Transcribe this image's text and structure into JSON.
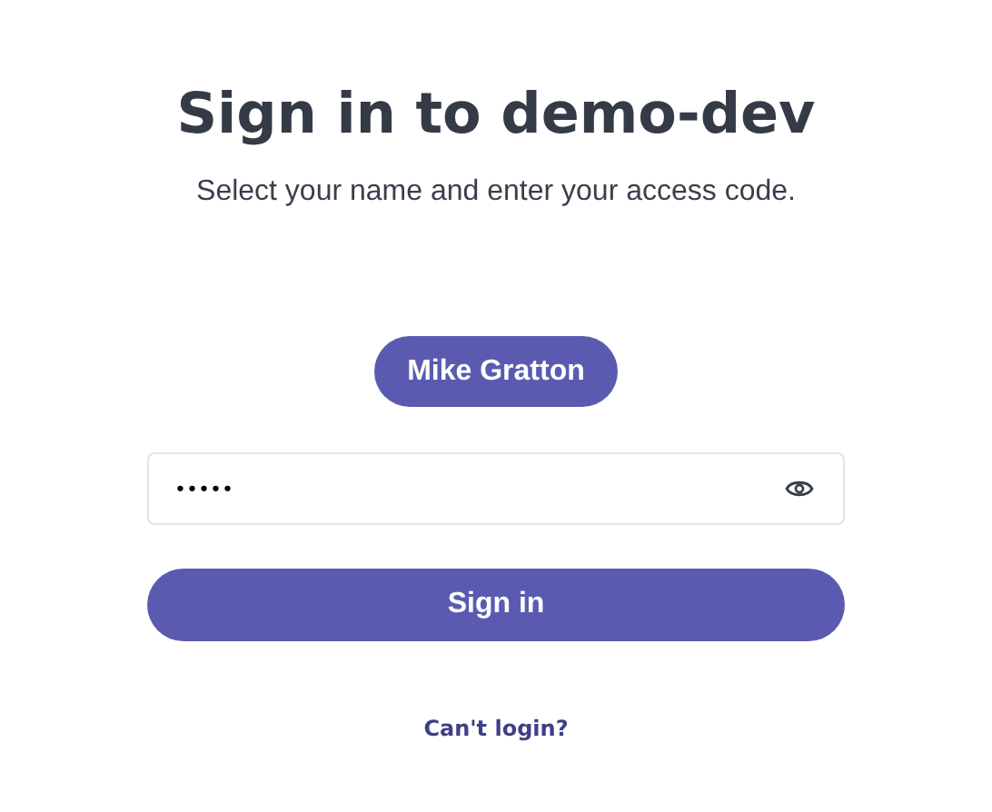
{
  "title": "Sign in to demo-dev",
  "subtitle": "Select your name and enter your access code.",
  "user_button": "Mike Gratton",
  "access_code": {
    "value": "•••••",
    "masked": true
  },
  "sign_in_button": "Sign in",
  "help_link": "Can't login?"
}
